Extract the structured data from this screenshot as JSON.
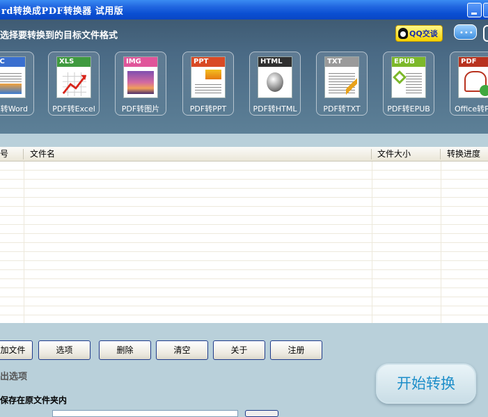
{
  "window": {
    "title": "rd转换成PDF转换器  试用版"
  },
  "header": {
    "instruction": "选择要转换到的目标文件格式",
    "qq_label": "QQ交谈",
    "tools": [
      {
        "badge": "OC",
        "label": "F转Word",
        "color": "#3a6fcf"
      },
      {
        "badge": "XLS",
        "label": "PDF转Excel",
        "color": "#3f9a3f"
      },
      {
        "badge": "IMG",
        "label": "PDF转图片",
        "color": "#e0559a"
      },
      {
        "badge": "PPT",
        "label": "PDF转PPT",
        "color": "#d94a25"
      },
      {
        "badge": "HTML",
        "label": "PDF转HTML",
        "color": "#303030"
      },
      {
        "badge": "TXT",
        "label": "PDF转TXT",
        "color": "#9a9a9a"
      },
      {
        "badge": "EPUB",
        "label": "PDF转EPUB",
        "color": "#7cb82a"
      },
      {
        "badge": "PDF",
        "label": "Office转PI",
        "color": "#b8321f"
      }
    ]
  },
  "table": {
    "columns": [
      "号",
      "文件名",
      "文件大小",
      "转换进度"
    ]
  },
  "buttons": {
    "add": "加文件",
    "options": "选项",
    "delete": "删除",
    "clear": "清空",
    "about": "关于",
    "register": "注册"
  },
  "output": {
    "title": "出选项",
    "save_original": "保存在原文件夹内"
  },
  "start_label": "开始转换"
}
